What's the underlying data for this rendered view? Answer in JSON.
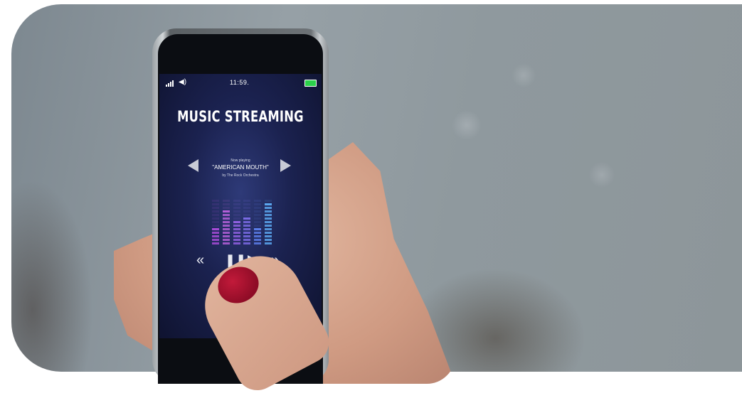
{
  "status_bar": {
    "time": "11:59.",
    "signal_icon": "signal-icon",
    "volume_icon": "volume-icon",
    "battery_icon": "battery-icon"
  },
  "app": {
    "title": "MUSIC STREAMING",
    "now_playing_label": "Now playing",
    "song_title": "\"AMERICAN MOUTH\"",
    "artist": "by The Rock Orchestra"
  },
  "equalizer_levels": [
    0.38,
    0.76,
    0.5,
    0.63,
    0.38,
    0.9
  ],
  "equalizer_colors": [
    "#a64bd6",
    "#b35fd8",
    "#8f5fe0",
    "#7a6ae3",
    "#5a7de8",
    "#5aa6ef"
  ],
  "controls": [
    "rewind-icon",
    "pause-icon",
    "play-icon",
    "fast-forward-icon"
  ]
}
